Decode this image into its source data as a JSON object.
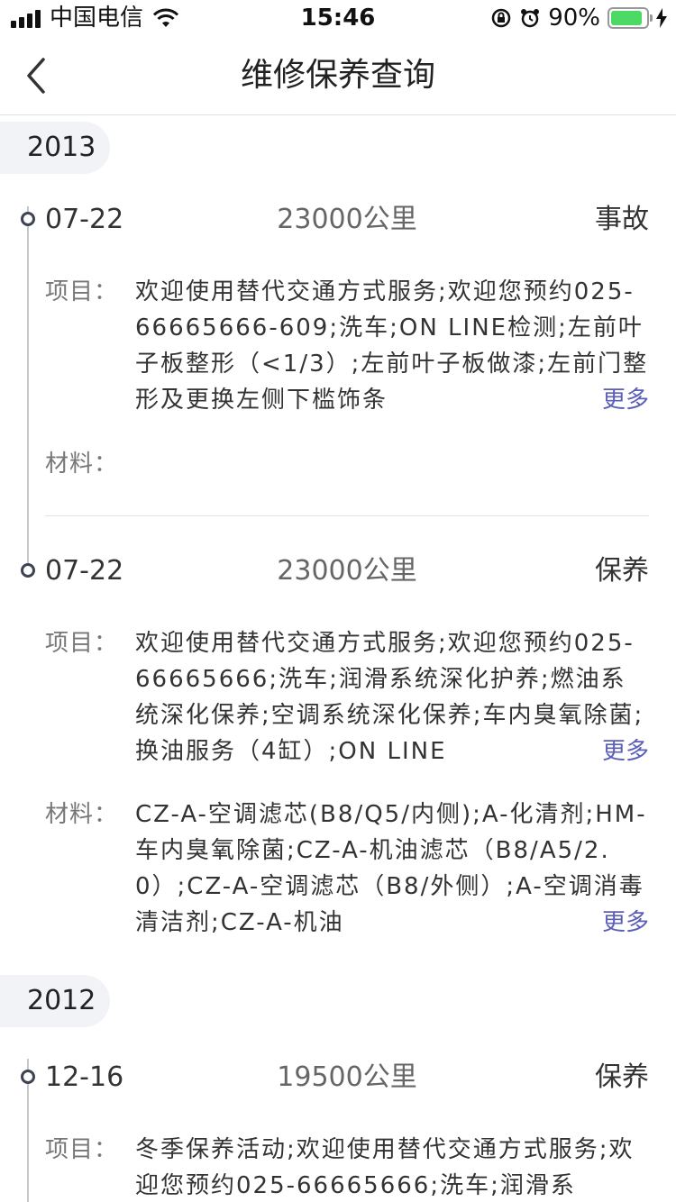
{
  "status_bar": {
    "carrier": "中国电信",
    "time": "15:46",
    "battery_percent_text": "90%",
    "battery_level": 0.9
  },
  "nav": {
    "title": "维修保养查询"
  },
  "labels": {
    "items": "项目：",
    "materials": "材料：",
    "more": "更多"
  },
  "years": [
    {
      "year": "2013",
      "records": [
        {
          "date": "07-22",
          "mileage": "23000公里",
          "type": "事故",
          "items": "欢迎使用替代交通方式服务;欢迎您预约025-66665666-609;洗车;ON LINE检测;左前叶子板整形（<1/3）;左前叶子板做漆;左前门整形及更换左侧下槛饰条",
          "materials": ""
        },
        {
          "date": "07-22",
          "mileage": "23000公里",
          "type": "保养",
          "items": "欢迎使用替代交通方式服务;欢迎您预约025-66665666;洗车;润滑系统深化护养;燃油系统深化保养;空调系统深化保养;车内臭氧除菌;换油服务（4缸）;ON LINE",
          "materials": "CZ-A-空调滤芯(B8/Q5/内侧);A-化清剂;HM-车内臭氧除菌;CZ-A-机油滤芯（B8/A5/2.0）;CZ-A-空调滤芯（B8/外侧）;A-空调消毒清洁剂;CZ-A-机油"
        }
      ]
    },
    {
      "year": "2012",
      "records": [
        {
          "date": "12-16",
          "mileage": "19500公里",
          "type": "保养",
          "items": "冬季保养活动;欢迎使用替代交通方式服务;欢迎您预约025-66665666;洗车;润滑系",
          "materials": ""
        }
      ]
    }
  ],
  "colors": {
    "accent_more": "#5b5fb8",
    "battery_green": "#4cd964",
    "timeline": "#c6c8cc",
    "year_badge_bg": "#f1f3f6"
  }
}
